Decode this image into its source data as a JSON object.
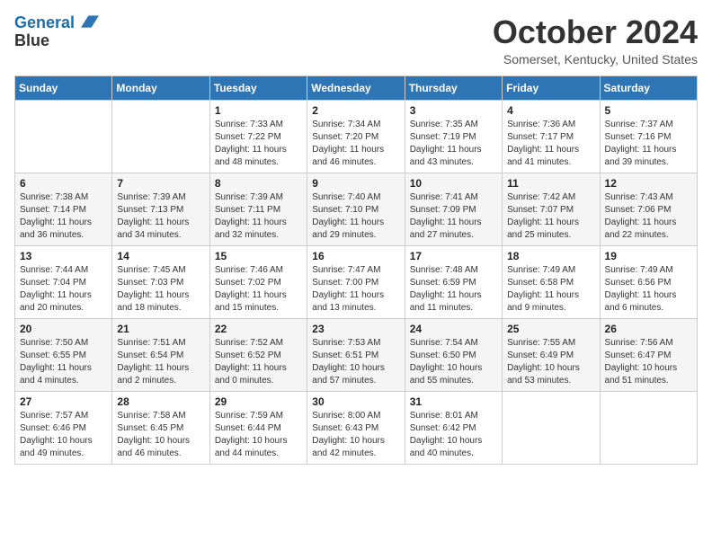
{
  "header": {
    "logo_line1": "General",
    "logo_line2": "Blue",
    "month": "October 2024",
    "location": "Somerset, Kentucky, United States"
  },
  "weekdays": [
    "Sunday",
    "Monday",
    "Tuesday",
    "Wednesday",
    "Thursday",
    "Friday",
    "Saturday"
  ],
  "weeks": [
    [
      {
        "day": "",
        "info": ""
      },
      {
        "day": "",
        "info": ""
      },
      {
        "day": "1",
        "info": "Sunrise: 7:33 AM\nSunset: 7:22 PM\nDaylight: 11 hours and 48 minutes."
      },
      {
        "day": "2",
        "info": "Sunrise: 7:34 AM\nSunset: 7:20 PM\nDaylight: 11 hours and 46 minutes."
      },
      {
        "day": "3",
        "info": "Sunrise: 7:35 AM\nSunset: 7:19 PM\nDaylight: 11 hours and 43 minutes."
      },
      {
        "day": "4",
        "info": "Sunrise: 7:36 AM\nSunset: 7:17 PM\nDaylight: 11 hours and 41 minutes."
      },
      {
        "day": "5",
        "info": "Sunrise: 7:37 AM\nSunset: 7:16 PM\nDaylight: 11 hours and 39 minutes."
      }
    ],
    [
      {
        "day": "6",
        "info": "Sunrise: 7:38 AM\nSunset: 7:14 PM\nDaylight: 11 hours and 36 minutes."
      },
      {
        "day": "7",
        "info": "Sunrise: 7:39 AM\nSunset: 7:13 PM\nDaylight: 11 hours and 34 minutes."
      },
      {
        "day": "8",
        "info": "Sunrise: 7:39 AM\nSunset: 7:11 PM\nDaylight: 11 hours and 32 minutes."
      },
      {
        "day": "9",
        "info": "Sunrise: 7:40 AM\nSunset: 7:10 PM\nDaylight: 11 hours and 29 minutes."
      },
      {
        "day": "10",
        "info": "Sunrise: 7:41 AM\nSunset: 7:09 PM\nDaylight: 11 hours and 27 minutes."
      },
      {
        "day": "11",
        "info": "Sunrise: 7:42 AM\nSunset: 7:07 PM\nDaylight: 11 hours and 25 minutes."
      },
      {
        "day": "12",
        "info": "Sunrise: 7:43 AM\nSunset: 7:06 PM\nDaylight: 11 hours and 22 minutes."
      }
    ],
    [
      {
        "day": "13",
        "info": "Sunrise: 7:44 AM\nSunset: 7:04 PM\nDaylight: 11 hours and 20 minutes."
      },
      {
        "day": "14",
        "info": "Sunrise: 7:45 AM\nSunset: 7:03 PM\nDaylight: 11 hours and 18 minutes."
      },
      {
        "day": "15",
        "info": "Sunrise: 7:46 AM\nSunset: 7:02 PM\nDaylight: 11 hours and 15 minutes."
      },
      {
        "day": "16",
        "info": "Sunrise: 7:47 AM\nSunset: 7:00 PM\nDaylight: 11 hours and 13 minutes."
      },
      {
        "day": "17",
        "info": "Sunrise: 7:48 AM\nSunset: 6:59 PM\nDaylight: 11 hours and 11 minutes."
      },
      {
        "day": "18",
        "info": "Sunrise: 7:49 AM\nSunset: 6:58 PM\nDaylight: 11 hours and 9 minutes."
      },
      {
        "day": "19",
        "info": "Sunrise: 7:49 AM\nSunset: 6:56 PM\nDaylight: 11 hours and 6 minutes."
      }
    ],
    [
      {
        "day": "20",
        "info": "Sunrise: 7:50 AM\nSunset: 6:55 PM\nDaylight: 11 hours and 4 minutes."
      },
      {
        "day": "21",
        "info": "Sunrise: 7:51 AM\nSunset: 6:54 PM\nDaylight: 11 hours and 2 minutes."
      },
      {
        "day": "22",
        "info": "Sunrise: 7:52 AM\nSunset: 6:52 PM\nDaylight: 11 hours and 0 minutes."
      },
      {
        "day": "23",
        "info": "Sunrise: 7:53 AM\nSunset: 6:51 PM\nDaylight: 10 hours and 57 minutes."
      },
      {
        "day": "24",
        "info": "Sunrise: 7:54 AM\nSunset: 6:50 PM\nDaylight: 10 hours and 55 minutes."
      },
      {
        "day": "25",
        "info": "Sunrise: 7:55 AM\nSunset: 6:49 PM\nDaylight: 10 hours and 53 minutes."
      },
      {
        "day": "26",
        "info": "Sunrise: 7:56 AM\nSunset: 6:47 PM\nDaylight: 10 hours and 51 minutes."
      }
    ],
    [
      {
        "day": "27",
        "info": "Sunrise: 7:57 AM\nSunset: 6:46 PM\nDaylight: 10 hours and 49 minutes."
      },
      {
        "day": "28",
        "info": "Sunrise: 7:58 AM\nSunset: 6:45 PM\nDaylight: 10 hours and 46 minutes."
      },
      {
        "day": "29",
        "info": "Sunrise: 7:59 AM\nSunset: 6:44 PM\nDaylight: 10 hours and 44 minutes."
      },
      {
        "day": "30",
        "info": "Sunrise: 8:00 AM\nSunset: 6:43 PM\nDaylight: 10 hours and 42 minutes."
      },
      {
        "day": "31",
        "info": "Sunrise: 8:01 AM\nSunset: 6:42 PM\nDaylight: 10 hours and 40 minutes."
      },
      {
        "day": "",
        "info": ""
      },
      {
        "day": "",
        "info": ""
      }
    ]
  ]
}
